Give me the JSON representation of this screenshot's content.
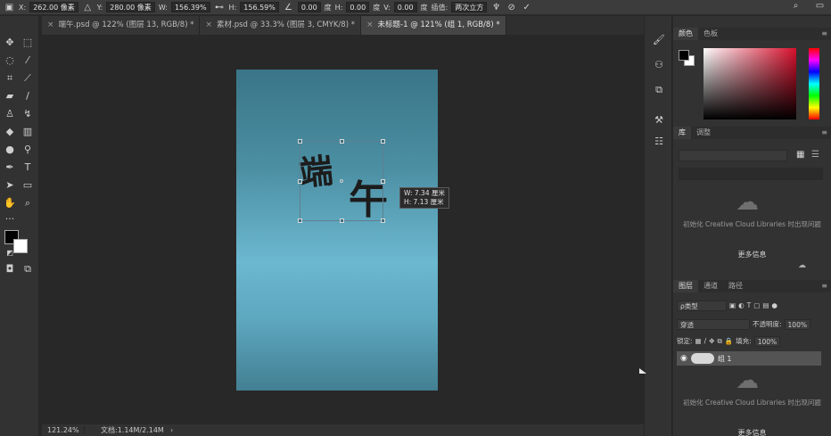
{
  "options_bar": {
    "x_label": "X:",
    "x_value": "262.00 像素",
    "y_label": "Y:",
    "y_value": "280.00 像素",
    "w_label": "W:",
    "w_value": "156.39%",
    "h_label": "H:",
    "h_value": "156.59%",
    "angle_value": "0.00",
    "deg_label": "度",
    "hskew_label": "H:",
    "hskew_value": "0.00",
    "hskew_unit": "度",
    "vskew_label": "V:",
    "vskew_value": "0.00",
    "vskew_unit": "度",
    "interp_label": "插值:",
    "interp_value": "两次立方"
  },
  "tabs": [
    {
      "label": "端午.psd @ 122% (图层 13, RGB/8) *"
    },
    {
      "label": "素材.psd @ 33.3% (图层 3, CMYK/8) *"
    },
    {
      "label": "未标题-1 @ 121% (组 1, RGB/8) *"
    }
  ],
  "canvas": {
    "char1": "端",
    "char2": "午",
    "tooltip_w": "W: 7.34 厘米",
    "tooltip_h": "H: 7.13 厘米"
  },
  "status": {
    "zoom": "121.24%",
    "doc_info": "文档:1.14M/2.14M"
  },
  "color_panel": {
    "tab_color": "颜色",
    "tab_swatches": "色板"
  },
  "library_panel": {
    "tab_library": "库",
    "tab_adjust": "调整",
    "message": "初始化 Creative Cloud Libraries 时出现问题",
    "more": "更多信息"
  },
  "layers_panel": {
    "tab_layers": "图层",
    "tab_channels": "通道",
    "tab_paths": "路径",
    "filter_kind": "ρ类型",
    "blend_mode": "穿透",
    "opacity_label": "不透明度:",
    "opacity_value": "100%",
    "lock_label": "锁定:",
    "fill_label": "填充:",
    "fill_value": "100%",
    "layer_name": "组 1",
    "message": "初始化 Creative Cloud Libraries 时出现问题",
    "more": "更多信息"
  },
  "colors": {
    "accent_red": "#d8102d",
    "panel_bg": "#323232",
    "canvas_bg": "#282828"
  }
}
